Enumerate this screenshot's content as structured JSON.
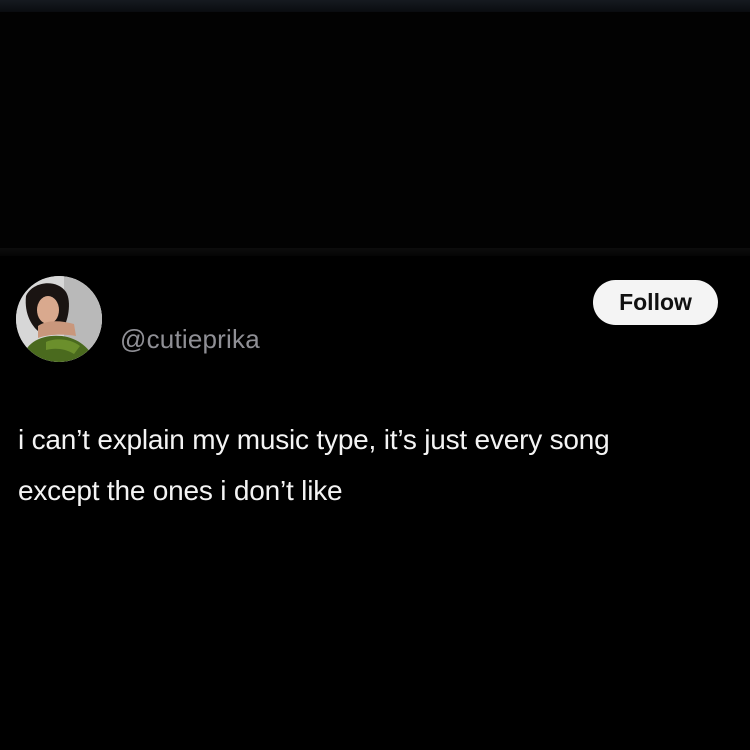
{
  "post": {
    "handle": "@cutieprika",
    "follow_label": "Follow",
    "text_line_1": "i can’t explain my music type, it’s just every song",
    "text_line_2": "except the ones i don’t like"
  },
  "colors": {
    "background": "#000000",
    "text": "#f4f4f4",
    "handle": "#8f8f95",
    "button_bg": "#f4f4f4",
    "button_text": "#111111"
  }
}
